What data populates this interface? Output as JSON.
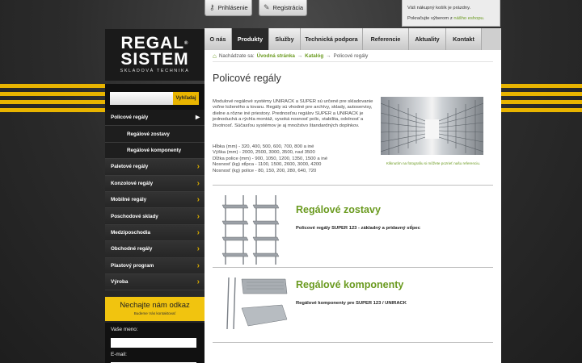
{
  "top": {
    "login_label": "Prihlásenie",
    "register_label": "Registrácia",
    "cart_line1": "Váš nákupný košík je prázdny.",
    "cart_line2_prefix": "Pokračujte výberom z ",
    "cart_line2_link": "nášho eshopu."
  },
  "logo": {
    "line1": "REGAL",
    "line2": "SISTEM",
    "reg": "®",
    "tagline": "SKLADOVÁ TECHNIKA"
  },
  "search": {
    "button_label": "Vyhľadaj",
    "value": ""
  },
  "sidebar": {
    "items": [
      {
        "label": "Policové regály",
        "active": true,
        "sub": false
      },
      {
        "label": "Regálové zostavy",
        "active": false,
        "sub": true
      },
      {
        "label": "Regálové komponenty",
        "active": false,
        "sub": true
      },
      {
        "label": "Paletové regály",
        "active": false,
        "sub": false
      },
      {
        "label": "Konzolové regály",
        "active": false,
        "sub": false
      },
      {
        "label": "Mobilné regály",
        "active": false,
        "sub": false
      },
      {
        "label": "Poschodové sklady",
        "active": false,
        "sub": false
      },
      {
        "label": "Medziposchodia",
        "active": false,
        "sub": false
      },
      {
        "label": "Obchodné regály",
        "active": false,
        "sub": false
      },
      {
        "label": "Plastový program",
        "active": false,
        "sub": false
      },
      {
        "label": "Výroba",
        "active": false,
        "sub": false
      }
    ]
  },
  "promo": {
    "title": "Nechajte nám odkaz",
    "subtitle": "Budeme Vás kontaktovať"
  },
  "form": {
    "name_label": "Vaše meno:",
    "email_label": "E-mail:",
    "email_value": "@"
  },
  "nav": {
    "tabs": [
      {
        "label": "O nás",
        "active": false
      },
      {
        "label": "Produkty",
        "active": true
      },
      {
        "label": "Služby",
        "active": false
      },
      {
        "label": "Technická podpora",
        "active": false
      },
      {
        "label": "Referencie",
        "active": false
      },
      {
        "label": "Aktuality",
        "active": false
      },
      {
        "label": "Kontakt",
        "active": false
      }
    ]
  },
  "breadcrumb": {
    "prefix": "Nachádzate sa:",
    "home": "Úvodná stránka",
    "sep": "→",
    "catalog": "Katalóg",
    "current": "Policové regály"
  },
  "main": {
    "title": "Policové regály",
    "intro": "Modulové regálové systémy UNIRACK a SUPER sú určené pre skladovanie voľne loženého a tovaru. Regály sú vhodné pre archívy, sklady, autoservisy, dielne a rôzne iné priestory. Prednosťou regálov SUPER a UNIRACK je jednoduchá a rýchla montáž, vysoká nosnosť polic, stabilita, odolnosť a životnosť. Súčasťou systémov je aj množstvo štandardných doplnkov.",
    "specs": [
      "Hĺbka (mm) - 320, 400, 500, 600, 700, 800 a iné",
      "Výška (mm) - 2000, 2500, 3000, 3500, nad 3500",
      "Dĺžka police (mm) - 900, 1050, 1200, 1350, 1500 a iné",
      "Nosnosť (kg) stĺpca - 1100, 1500, 2600, 3000, 4200",
      "Nosnosť (kg) police - 80, 150, 200, 280, 640, 720"
    ],
    "photo_caption": "Kliknutím na fotografiu si môžete pozrieť našu referenciu."
  },
  "categories": [
    {
      "title": "Regálové zostavy",
      "desc": "Policové regály SUPER 123 - základný a pridavný stĺpec"
    },
    {
      "title": "Regálové komponenty",
      "desc": "Regálové komponenty pre SUPER 123 / UNIRACK"
    }
  ],
  "colors": {
    "accent": "#e8b400",
    "link_green": "#6a9a1f",
    "dark": "#2a2a2a"
  }
}
